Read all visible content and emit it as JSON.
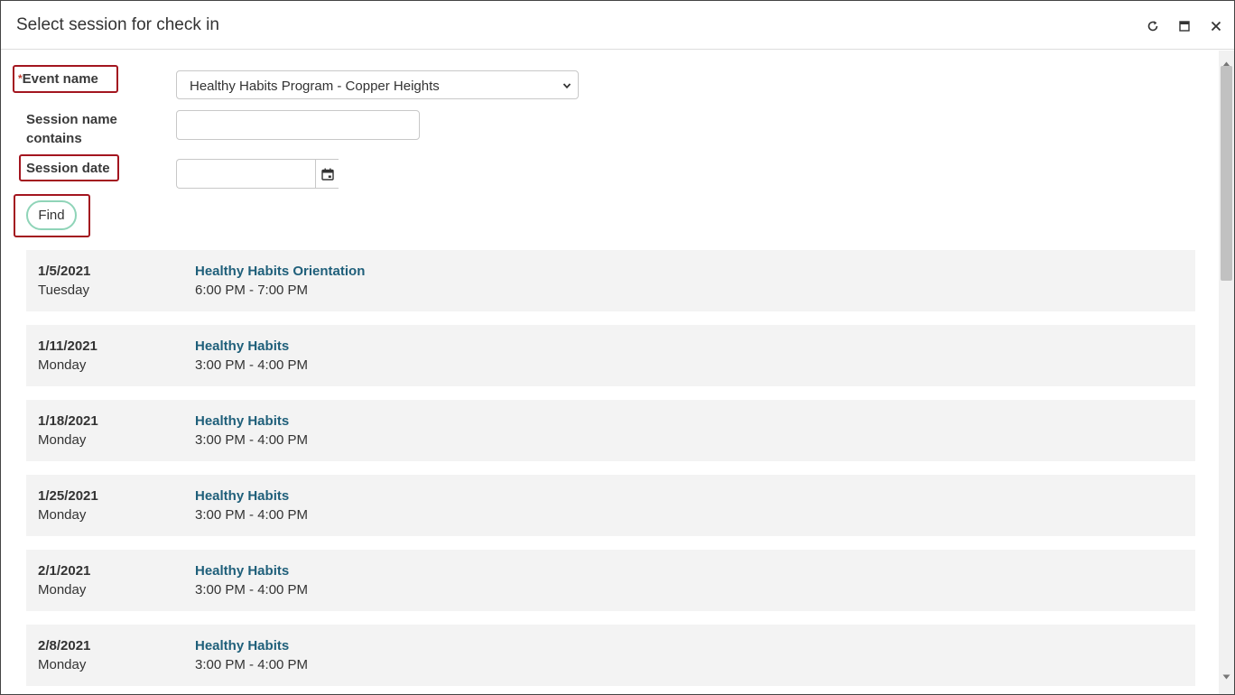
{
  "window": {
    "title": "Select session for check in",
    "refresh_icon": "refresh-icon",
    "maximize_icon": "maximize-icon",
    "close_icon": "close-icon"
  },
  "form": {
    "required_mark": "*",
    "event_name_label": "Event name",
    "event_name_value": "Healthy Habits Program - Copper Heights",
    "session_name_label_line1": "Session name",
    "session_name_label_line2": "contains",
    "session_name_value": "",
    "session_date_label": "Session date",
    "session_date_value": "",
    "calendar_icon": "calendar-icon",
    "find_label": "Find"
  },
  "sessions": [
    {
      "date": "1/5/2021",
      "day": "Tuesday",
      "name": "Healthy Habits Orientation",
      "time": "6:00 PM - 7:00 PM"
    },
    {
      "date": "1/11/2021",
      "day": "Monday",
      "name": "Healthy Habits",
      "time": "3:00 PM - 4:00 PM"
    },
    {
      "date": "1/18/2021",
      "day": "Monday",
      "name": "Healthy Habits",
      "time": "3:00 PM - 4:00 PM"
    },
    {
      "date": "1/25/2021",
      "day": "Monday",
      "name": "Healthy Habits",
      "time": "3:00 PM - 4:00 PM"
    },
    {
      "date": "2/1/2021",
      "day": "Monday",
      "name": "Healthy Habits",
      "time": "3:00 PM - 4:00 PM"
    },
    {
      "date": "2/8/2021",
      "day": "Monday",
      "name": "Healthy Habits",
      "time": "3:00 PM - 4:00 PM"
    }
  ],
  "colors": {
    "highlight": "#a3151f",
    "link": "#1f5f7a",
    "row_background": "#f3f3f3",
    "find_border": "#8fd4b8"
  }
}
